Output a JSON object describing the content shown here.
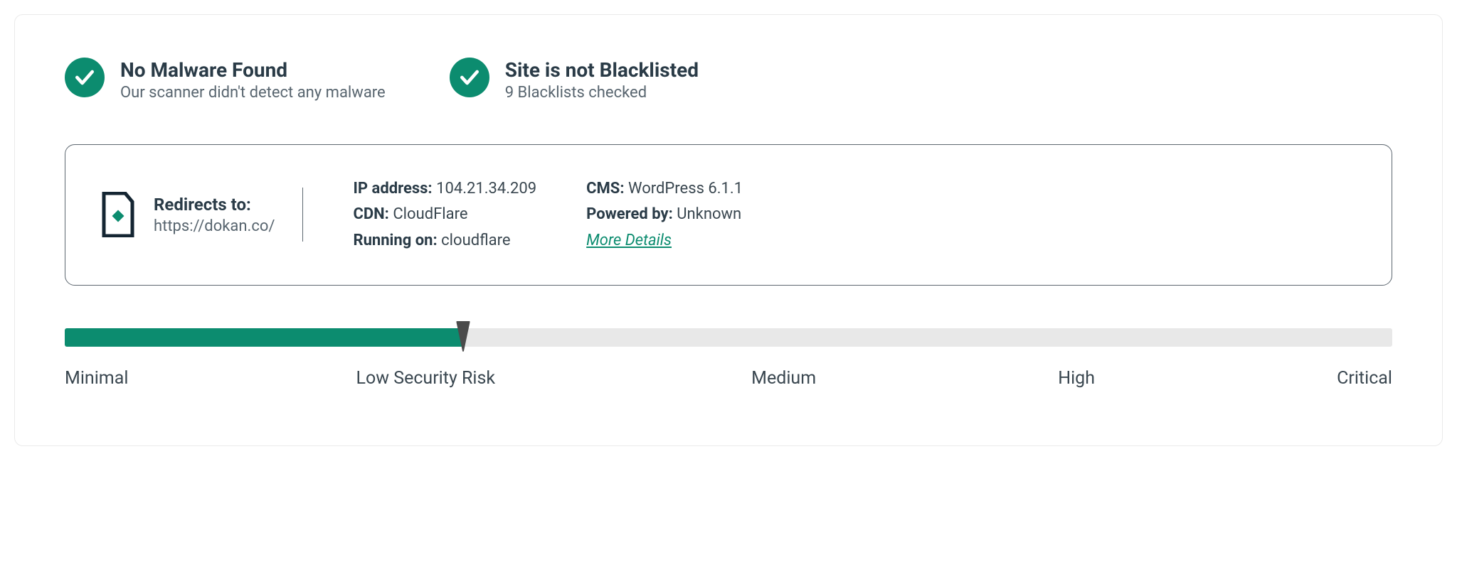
{
  "colors": {
    "accent": "#0c8c6f"
  },
  "status": {
    "malware": {
      "title": "No Malware Found",
      "subtitle": "Our scanner didn't detect any malware"
    },
    "blacklist": {
      "title": "Site is not Blacklisted",
      "subtitle": "9 Blacklists checked"
    }
  },
  "details": {
    "redirects_label": "Redirects to:",
    "redirects_url": "https://dokan.co/",
    "col1": {
      "ip_label": "IP address:",
      "ip_value": "104.21.34.209",
      "cdn_label": "CDN:",
      "cdn_value": "CloudFlare",
      "running_label": "Running on:",
      "running_value": "cloudflare"
    },
    "col2": {
      "cms_label": "CMS:",
      "cms_value": "WordPress 6.1.1",
      "powered_label": "Powered by:",
      "powered_value": "Unknown",
      "more_link": "More Details"
    }
  },
  "risk": {
    "percent": 30,
    "labels": [
      "Minimal",
      "Low Security Risk",
      "Medium",
      "High",
      "Critical"
    ]
  }
}
